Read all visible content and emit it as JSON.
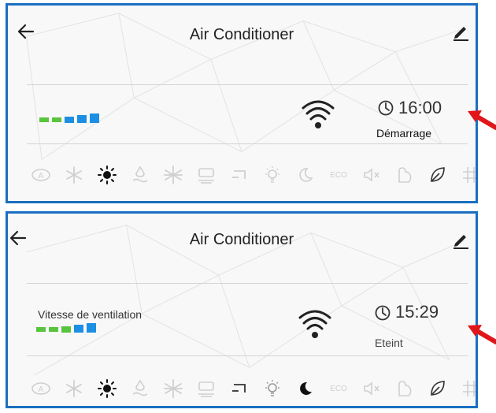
{
  "colors": {
    "frame": "#1a6fc0",
    "speed_green": "#59c43e",
    "speed_blue": "#1d8fe3",
    "heat_active": "#111111",
    "icon_inactive": "#cfcfcf",
    "arrow_red": "#e0161b"
  },
  "panels": [
    {
      "title": "Air Conditioner",
      "fan_speed_label": "",
      "timer_time": "16:00",
      "timer_status": "Démarrage",
      "modes": [
        {
          "icon": "auto-icon",
          "active": false
        },
        {
          "icon": "snowflake-icon",
          "active": false
        },
        {
          "icon": "sun-icon",
          "active": true
        },
        {
          "icon": "dehumidify-icon",
          "active": false
        },
        {
          "icon": "fan-icon",
          "active": false
        },
        {
          "icon": "heater-icon",
          "active": false
        },
        {
          "icon": "swing-icon",
          "active": false
        },
        {
          "icon": "light-icon",
          "active": false
        },
        {
          "icon": "sleep-icon",
          "active": false
        },
        {
          "label": "ECO",
          "active": false
        },
        {
          "icon": "mute-icon",
          "active": false
        },
        {
          "icon": "follow-icon",
          "active": false
        },
        {
          "icon": "leaf-icon",
          "active": false
        },
        {
          "icon": "grid-icon",
          "active": false
        }
      ]
    },
    {
      "title": "Air Conditioner",
      "fan_speed_label": "Vitesse de ventilation",
      "timer_time": "15:29",
      "timer_status": "Eteint",
      "modes": [
        {
          "icon": "auto-icon",
          "active": false
        },
        {
          "icon": "snowflake-icon",
          "active": false
        },
        {
          "icon": "sun-icon",
          "active": true
        },
        {
          "icon": "dehumidify-icon",
          "active": false
        },
        {
          "icon": "fan-icon",
          "active": false
        },
        {
          "icon": "heater-icon",
          "active": false
        },
        {
          "icon": "swing-icon",
          "active": false
        },
        {
          "icon": "light-icon",
          "active": false
        },
        {
          "icon": "sleep-icon",
          "active": false
        },
        {
          "label": "ECO",
          "active": false
        },
        {
          "icon": "mute-icon",
          "active": false
        },
        {
          "icon": "follow-icon",
          "active": false
        },
        {
          "icon": "leaf-icon",
          "active": false
        },
        {
          "icon": "grid-icon",
          "active": false
        }
      ]
    }
  ]
}
